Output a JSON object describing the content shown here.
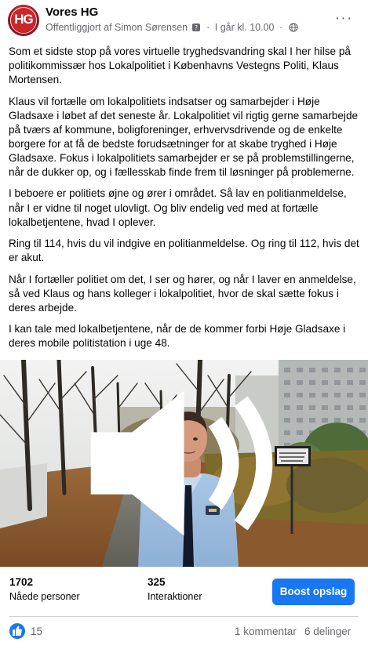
{
  "post": {
    "page_name": "Vores HG",
    "avatar_text": "HG",
    "published_by": "Offentliggjort af Simon Sørensen",
    "separator": "·",
    "time": "I går kl. 10.00",
    "more_label": "···",
    "paragraphs": [
      "Som et sidste stop på vores virtuelle tryghedsvandring skal I her hilse på politikommissær hos Lokalpolitiet i Københavns Vestegns Politi, Klaus Mortensen.",
      "Klaus vil fortælle om lokalpolitiets indsatser og samarbejder i Høje Gladsaxe i løbet af det seneste år. Lokalpolitiet vil rigtig gerne samarbejde på tværs af kommune, boligforeninger, erhvervsdrivende og de enkelte borgere for at få de bedste forudsætninger for at skabe tryghed i Høje Gladsaxe. Fokus i lokalpolitiets samarbejder er se på problemstillingerne, når de dukker op, og i fællesskab finde frem til løsninger på problemerne.",
      "I beboere er politiets øjne og ører i området. Så lav en politianmeldelse, når I er vidne til noget ulovligt. Og bliv endelig ved med at fortælle lokalbetjentene, hvad I oplever.",
      "Ring til 114, hvis du vil indgive en politianmeldelse. Og ring til 112, hvis det er akut.",
      "Når I fortæller politiet om det, I ser og hører, og når I laver en anmeldelse, så ved Klaus og hans kolleger i lokalpolitiet, hvor de skal sætte fokus i deres arbejde.",
      "I kan tale med lokalbetjentene, når de de kommer forbi Høje Gladsaxe i deres mobile politistation i uge 48."
    ]
  },
  "stats": {
    "reach_value": "1702",
    "reach_label": "Nåede personer",
    "interactions_value": "325",
    "interactions_label": "Interaktioner",
    "boost_label": "Boost opslag"
  },
  "footer": {
    "reactions": "15",
    "comments": "1 kommentar",
    "shares": "6 delinger"
  },
  "colors": {
    "accent": "#1877f2",
    "secondary_text": "#65676b",
    "brand_red": "#c8262b"
  },
  "icons": {
    "globe": "globe-icon",
    "more": "more-options-icon",
    "like": "like-reaction-icon",
    "audio": "audio-icon"
  }
}
